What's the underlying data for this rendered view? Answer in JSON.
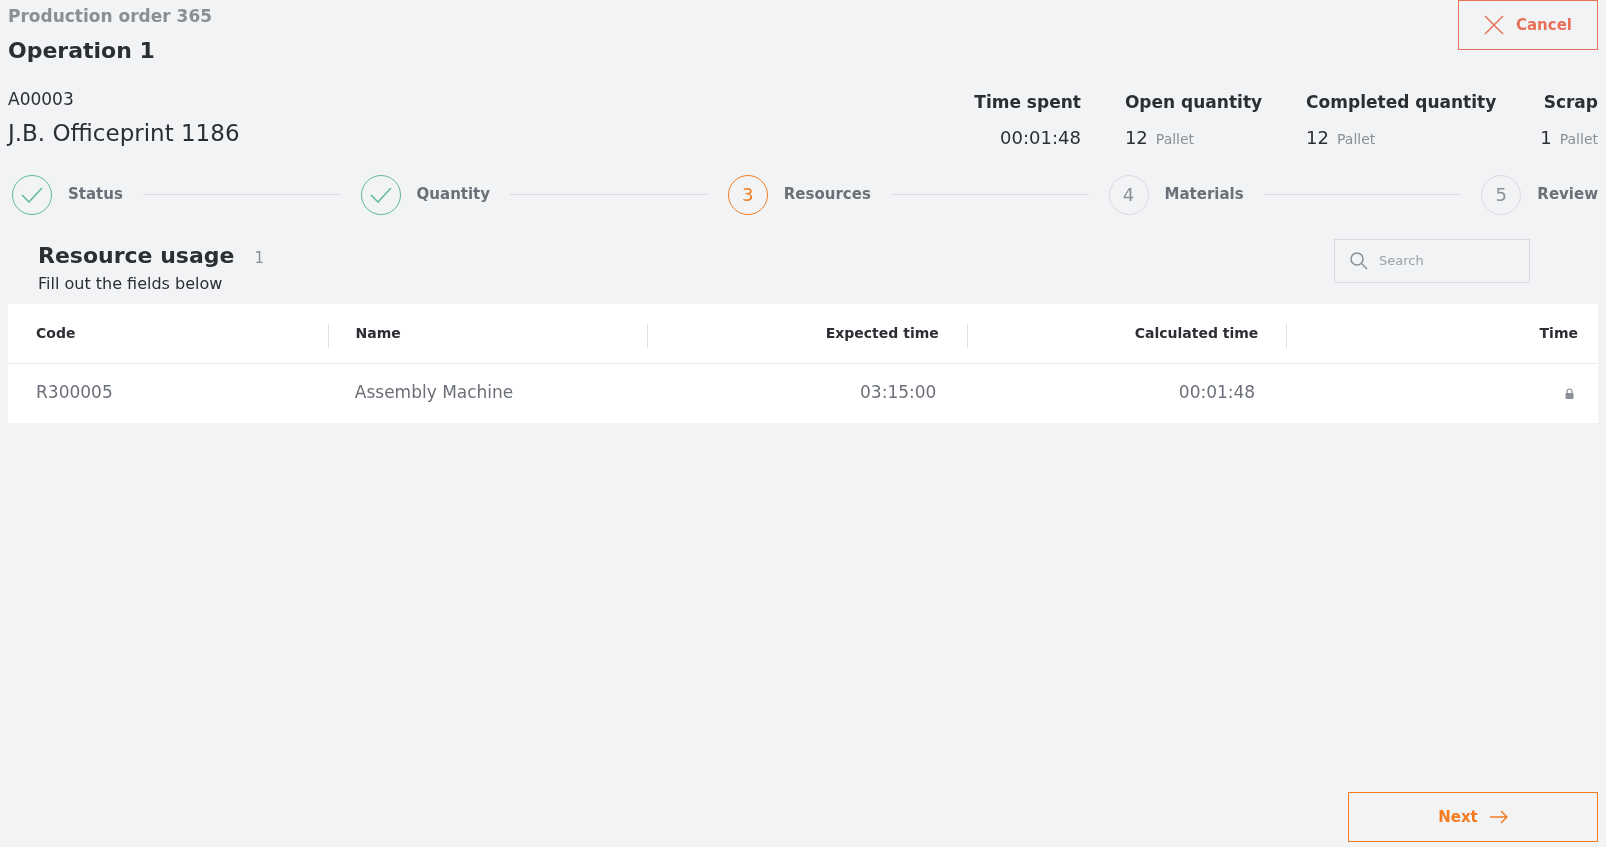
{
  "header": {
    "order": "Production order 365",
    "operation": "Operation 1",
    "item_code": "A00003",
    "item_name": "J.B. Officeprint 1186"
  },
  "cancel_button": "Cancel",
  "stats": [
    {
      "label": "Time spent",
      "value": "00:01:48"
    },
    {
      "label": "Open quantity",
      "value": "12",
      "unit": "Pallet"
    },
    {
      "label": "Completed quantity",
      "value": "12",
      "unit": "Pallet"
    },
    {
      "label": "Scrap",
      "value": "1",
      "unit": "Pallet"
    }
  ],
  "steps": [
    {
      "label": "Status",
      "completed": true,
      "selected": false
    },
    {
      "label": "Quantity",
      "completed": true,
      "selected": false
    },
    {
      "number": "3",
      "label": "Resources",
      "completed": false,
      "selected": true
    },
    {
      "number": "4",
      "label": "Materials",
      "completed": false,
      "selected": false
    },
    {
      "number": "5",
      "label": "Review",
      "completed": false,
      "selected": false
    }
  ],
  "section": {
    "title": "Resource usage",
    "count": "1",
    "subtitle": "Fill out the fields below"
  },
  "search": {
    "placeholder": "Search"
  },
  "table": {
    "columns": [
      {
        "label": "Code"
      },
      {
        "label": "Name"
      },
      {
        "label": "Expected time"
      },
      {
        "label": "Calculated time"
      },
      {
        "label": "Time"
      }
    ],
    "rows": [
      {
        "code": "R300005",
        "name": "Assembly Machine",
        "expected_time": "03:15:00",
        "calculated_time": "00:01:48",
        "time_locked": true
      }
    ]
  },
  "next_button": "Next"
}
